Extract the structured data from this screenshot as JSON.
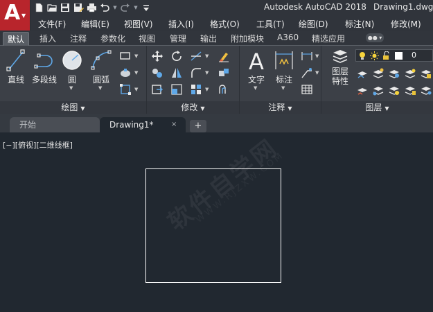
{
  "app": {
    "title": "Autodesk AutoCAD 2018",
    "filename": "Drawing1.dwg",
    "logo_letter": "A"
  },
  "quick_access": {
    "icons": [
      "new-icon",
      "open-icon",
      "save-icon",
      "saveas-icon",
      "print-icon",
      "undo-icon",
      "redo-icon",
      "customize-icon"
    ]
  },
  "menus": [
    "文件(F)",
    "编辑(E)",
    "视图(V)",
    "插入(I)",
    "格式(O)",
    "工具(T)",
    "绘图(D)",
    "标注(N)",
    "修改(M)"
  ],
  "ribbon_tabs": [
    "默认",
    "插入",
    "注释",
    "参数化",
    "视图",
    "管理",
    "输出",
    "附加模块",
    "A360",
    "精选应用"
  ],
  "panels": {
    "draw": {
      "title": "绘图",
      "tools": [
        "直线",
        "多段线",
        "圆",
        "圆弧"
      ]
    },
    "modify": {
      "title": "修改"
    },
    "annotation": {
      "title": "注释",
      "tools": [
        "文字",
        "标注"
      ]
    },
    "layers": {
      "title": "图层",
      "tool_line1": "图层",
      "tool_line2": "特性",
      "current_layer": "0"
    }
  },
  "doc_tabs": {
    "start": "开始",
    "drawing": "Drawing1*",
    "close": "×",
    "new": "+"
  },
  "viewport": {
    "label": "[−][俯视][二维线框]"
  },
  "watermark": {
    "text": "软件自学网",
    "url": "WWW.RJZXW.COM"
  },
  "colors": {
    "app_button": "#b8252c",
    "canvas": "#212830",
    "ribbon": "#3c4047"
  }
}
